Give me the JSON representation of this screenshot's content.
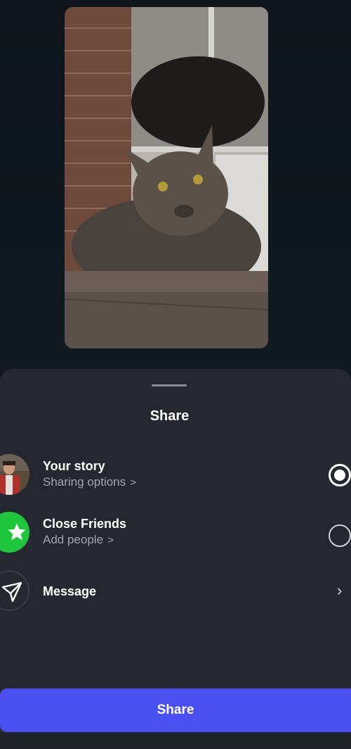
{
  "sheet": {
    "title": "Share"
  },
  "options": {
    "your_story": {
      "title": "Your story",
      "subtitle": "Sharing options",
      "selected": true
    },
    "close_friends": {
      "title": "Close Friends",
      "subtitle": "Add people",
      "selected": false
    },
    "message": {
      "title": "Message"
    }
  },
  "share_button": {
    "label": "Share"
  },
  "colors": {
    "sheet_bg": "#252830",
    "accent_button": "#4a4ff0",
    "close_friends_green": "#1ec63c"
  },
  "icons": {
    "close_friends": "star-icon",
    "message": "paper-plane-icon",
    "chevron": "chevron-right-icon"
  }
}
